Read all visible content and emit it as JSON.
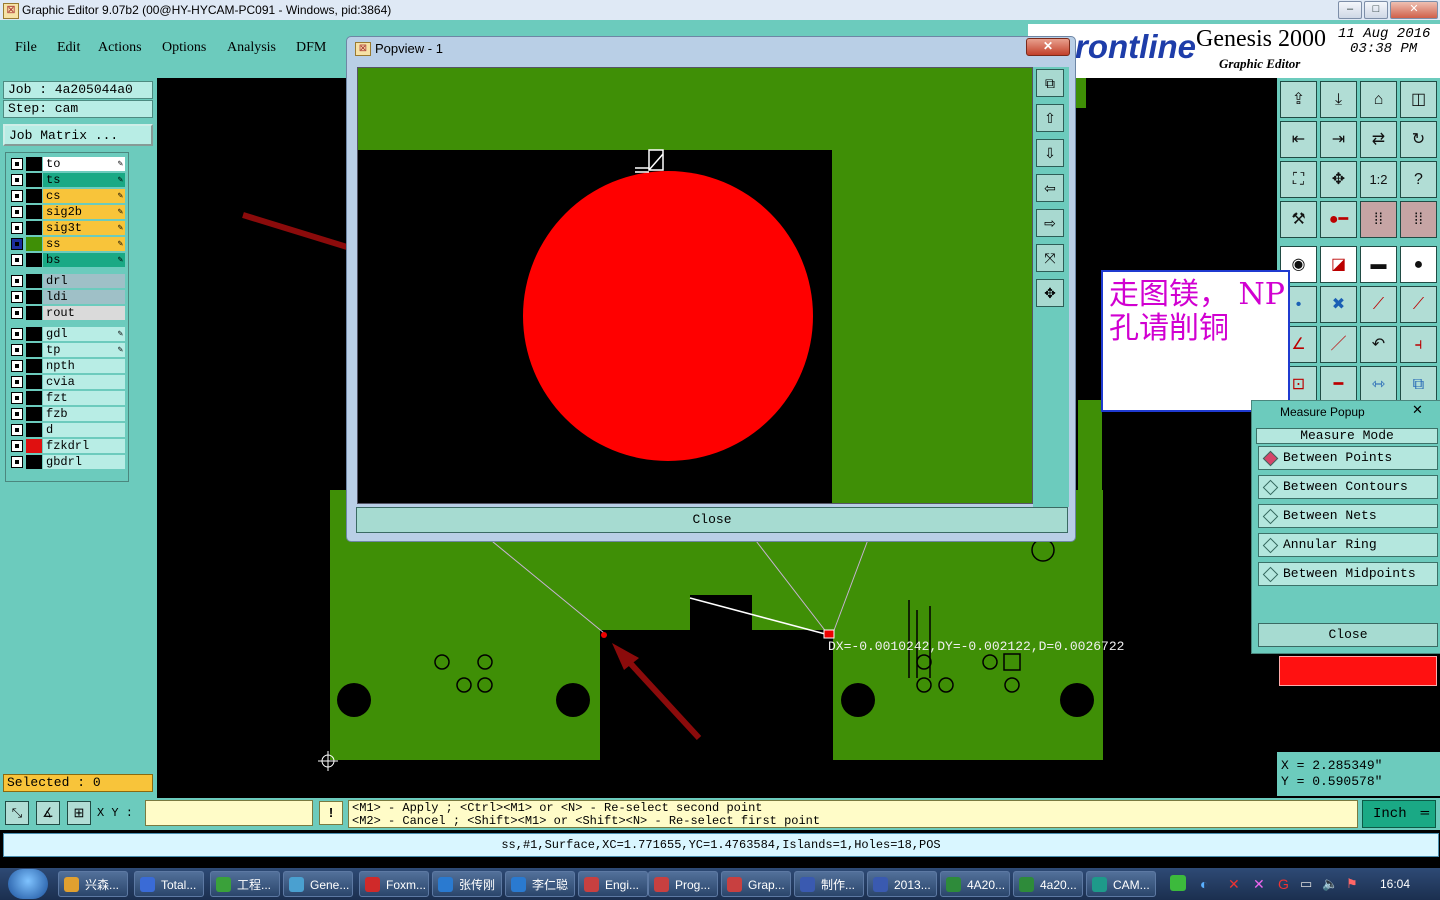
{
  "window": {
    "title": "Graphic Editor 9.07b2 (00@HY-HYCAM-PC091 - Windows, pid:3864)",
    "controls": [
      "–",
      "□",
      "✕"
    ]
  },
  "menu": [
    "File",
    "Edit",
    "Actions",
    "Options",
    "Analysis",
    "DFM"
  ],
  "brand": {
    "logo": "rontline",
    "product": "Genesis 2000",
    "subtitle": "Graphic Editor",
    "date": "11 Aug 2016",
    "time": "03:38 PM"
  },
  "job": {
    "job_label": "Job  :  4a205044a0",
    "step_label": "Step:  cam",
    "matrix_button": "Job Matrix ..."
  },
  "layers": [
    {
      "name": "to",
      "color": "#ffffff",
      "swatch": "#000000",
      "edit": true
    },
    {
      "name": "ts",
      "color": "#1aa985",
      "swatch": "#000000",
      "edit": true
    },
    {
      "name": "cs",
      "color": "#f8c43a",
      "swatch": "#000000",
      "edit": true
    },
    {
      "name": "sig2b",
      "color": "#f8c43a",
      "swatch": "#000000",
      "edit": true
    },
    {
      "name": "sig3t",
      "color": "#f8c43a",
      "swatch": "#000000",
      "edit": true
    },
    {
      "name": "ss",
      "color": "#f8c43a",
      "swatch": "#3f8f06",
      "edit": true,
      "active": true
    },
    {
      "name": "bs",
      "color": "#1aa985",
      "swatch": "#000000",
      "edit": true
    },
    {
      "name": "drl",
      "color": "#9fc0c7",
      "swatch": "#000000",
      "edit": false
    },
    {
      "name": "ldi",
      "color": "#9fc0c7",
      "swatch": "#000000",
      "edit": false
    },
    {
      "name": "rout",
      "color": "#dadada",
      "swatch": "#000000",
      "edit": false
    },
    {
      "name": "gdl",
      "color": "#b8ede5",
      "swatch": "#000000",
      "edit": true
    },
    {
      "name": "tp",
      "color": "#b8ede5",
      "swatch": "#000000",
      "edit": true
    },
    {
      "name": "npth",
      "color": "#b8ede5",
      "swatch": "#000000",
      "edit": false
    },
    {
      "name": "cvia",
      "color": "#b8ede5",
      "swatch": "#000000",
      "edit": false
    },
    {
      "name": "fzt",
      "color": "#b8ede5",
      "swatch": "#000000",
      "edit": false
    },
    {
      "name": "fzb",
      "color": "#b8ede5",
      "swatch": "#000000",
      "edit": false
    },
    {
      "name": "d",
      "color": "#b8ede5",
      "swatch": "#000000",
      "edit": false
    },
    {
      "name": "fzkdrl",
      "color": "#b8ede5",
      "swatch": "#e01010",
      "edit": false
    },
    {
      "name": "gbdrl",
      "color": "#b8ede5",
      "swatch": "#000000",
      "edit": false
    }
  ],
  "selected": "Selected : 0",
  "popview": {
    "title": "Popview - 1",
    "close_label": "Close",
    "pad_color": "#ff0000"
  },
  "note": "走图镁， NP孔请削铜",
  "measure": {
    "title": "Measure Popup",
    "mode_label": "Measure Mode",
    "options": [
      "Between Points",
      "Between Contours",
      "Between Nets",
      "Annular Ring",
      "Between Midpoints"
    ],
    "selected": "Between Points",
    "close_label": "Close"
  },
  "measure_readout": "DX=-0.0010242,DY=-0.002122,D=0.0026722",
  "coords": {
    "x": "X  =  2.285349\"",
    "y": "Y  =  0.590578\""
  },
  "xy_label": "X Y :",
  "hint": {
    "line1": "<M1> - Apply  ; <Ctrl><M1> or <N> - Re-select second point",
    "line2": "<M2> - Cancel ; <Shift><M1> or <Shift><N> - Re-select first point"
  },
  "units": "Inch",
  "status_line": "ss,#1,Surface,XC=1.771655,YC=1.4763584,Islands=1,Holes=18,POS",
  "taskbar": {
    "items": [
      {
        "label": "兴森...",
        "color": "#e0a030"
      },
      {
        "label": "Total...",
        "color": "#3a6bd6"
      },
      {
        "label": "工程...",
        "color": "#3aa13a"
      },
      {
        "label": "Gene...",
        "color": "#4aa0d0"
      },
      {
        "label": "Foxm...",
        "color": "#d02a2a"
      },
      {
        "label": "张传刚",
        "color": "#2a7ad0"
      },
      {
        "label": "李仁聪",
        "color": "#2a7ad0"
      },
      {
        "label": "Engi...",
        "color": "#c84040"
      },
      {
        "label": "Prog...",
        "color": "#c84040"
      },
      {
        "label": "Grap...",
        "color": "#c84040"
      },
      {
        "label": "制作...",
        "color": "#3a5ab0"
      },
      {
        "label": "2013...",
        "color": "#3a5ab0"
      },
      {
        "label": "4A20...",
        "color": "#2e8b3a"
      },
      {
        "label": "4a20...",
        "color": "#2e8b3a"
      },
      {
        "label": "CAM...",
        "color": "#1e9a8a"
      }
    ],
    "clock": "16:04"
  }
}
